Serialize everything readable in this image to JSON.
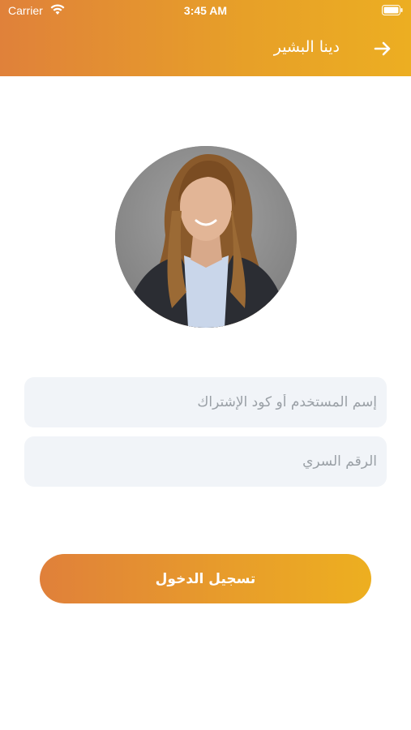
{
  "status_bar": {
    "carrier": "Carrier",
    "time": "3:45 AM",
    "wifi_icon": "wifi-icon",
    "battery_icon": "battery-icon"
  },
  "header": {
    "title": "دينا البشير",
    "back_icon": "arrow-right-icon",
    "gradient_start": "#e0813a",
    "gradient_end": "#ecae22"
  },
  "profile": {
    "avatar_icon": "profile-photo"
  },
  "form": {
    "username_placeholder": "إسم المستخدم أو كود الإشتراك",
    "password_placeholder": "الرقم السري",
    "field_background": "#f1f4f8"
  },
  "login_button": {
    "label": "تسجيل الدخول"
  }
}
